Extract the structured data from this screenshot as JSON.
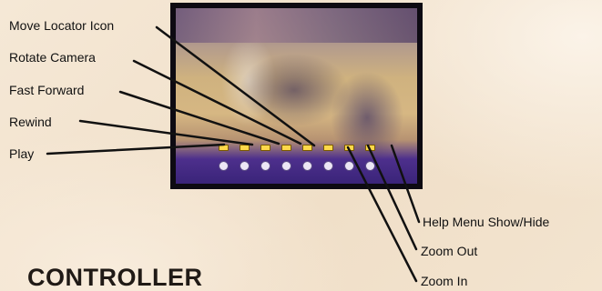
{
  "callouts": {
    "move_locator_icon": "Move Locator Icon",
    "rotate_camera": "Rotate Camera",
    "fast_forward": "Fast Forward",
    "rewind": "Rewind",
    "play": "Play",
    "help_menu": "Help Menu Show/Hide",
    "zoom_out": "Zoom Out",
    "zoom_in": "Zoom In"
  },
  "section_heading": "CONTROLLER",
  "colors": {
    "line": "#111111",
    "hud_marker": "#ffd84a",
    "court_purple": "#3a2479"
  }
}
